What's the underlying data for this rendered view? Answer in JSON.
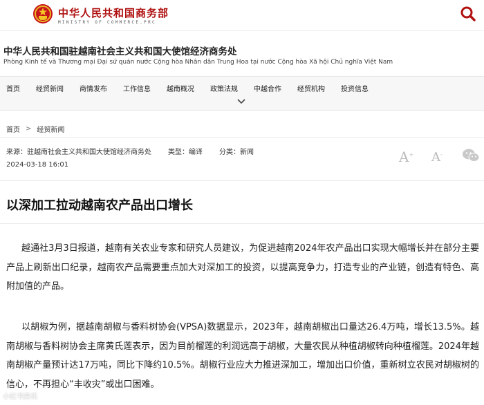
{
  "header": {
    "brand_cn": "中华人民共和国商务部",
    "brand_en": "MINISTRY OF COMMERCE.PRC",
    "accent": "#b01010",
    "emblem_icon": "national-emblem-icon",
    "search_icon": "search-icon"
  },
  "office": {
    "title": "中华人民共和国驻越南社会主义共和国大使馆经济商务处",
    "subtitle": "Phòng Kinh tế và Thương mại Đại sứ quán nước Cộng hòa Nhân dân Trung Hoa tại nước Cộng hòa Xã hội Chủ nghĩa Việt Nam"
  },
  "nav": {
    "items": [
      {
        "label": "首页"
      },
      {
        "label": "经贸新闻"
      },
      {
        "label": "商情发布"
      },
      {
        "label": "工作信息"
      },
      {
        "label": "越南概况"
      },
      {
        "label": "政策法规"
      },
      {
        "label": "中越合作"
      },
      {
        "label": "经贸机构"
      },
      {
        "label": "投资信息"
      }
    ],
    "expand_icon": "chevron-down-icon"
  },
  "breadcrumb": {
    "home": "首页",
    "separator": ">",
    "current": "经贸新闻"
  },
  "meta": {
    "source": "来源：驻越南社会主义共和国大使馆经济商务处",
    "type": "类型：编译",
    "category": "分类：新闻",
    "date": "2024-03-18 16:01",
    "font_larger": "A",
    "font_smaller": "A",
    "wechat_icon": "wechat-icon"
  },
  "article": {
    "title": "以深加工拉动越南农产品出口增长",
    "paragraphs": [
      "越通社3月3日报道，越南有关农业专家和研究人员建议，为促进越南2024年农产品出口实现大幅增长并在部分主要产品上刷新出口纪录，越南农产品需要重点加大对深加工的投资，以提高竞争力，打造专业的产业链，创造有特色、高附加值的产品。",
      "以胡椒为例，据越南胡椒与香料树协会(VPSA)数据显示，2023年，越南胡椒出口量达26.4万吨，增长13.5%。越南胡椒与香料树协会主席黄氏莲表示，因为目前榴莲的利润远高于胡椒，大量农民从种植胡椒转向种植榴莲。2024年越南胡椒产量预计达17万吨，同比下降约10.5%。胡椒行业应大力推进深加工，增加出口价值，重新树立农民对胡椒树的信心，不再担心“丰收灾”或出口困难。"
    ]
  },
  "watermark": "小红书资讯"
}
